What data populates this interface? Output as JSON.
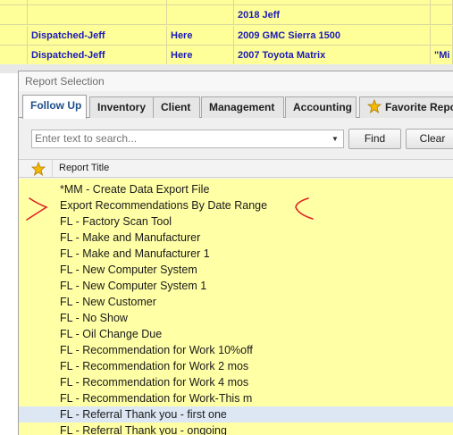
{
  "background_sheet": {
    "rows": [
      {
        "status": "",
        "location": "",
        "vehicle": "",
        "extra": ""
      },
      {
        "status": "",
        "location": "",
        "vehicle": "2018 Jeff",
        "extra": ""
      },
      {
        "status": "Dispatched-Jeff",
        "location": "Here",
        "vehicle": "2009 GMC Sierra 1500",
        "extra": ""
      },
      {
        "status": "Dispatched-Jeff",
        "location": "Here",
        "vehicle": "2007 Toyota Matrix",
        "extra": "\"Mi"
      }
    ]
  },
  "dialog": {
    "title": "Report Selection",
    "tabs": [
      {
        "label": "Follow Up",
        "active": true
      },
      {
        "label": "Inventory",
        "active": false
      },
      {
        "label": "Client",
        "active": false
      },
      {
        "label": "Management",
        "active": false
      },
      {
        "label": "Accounting",
        "active": false
      },
      {
        "label": "Favorite Repor",
        "active": false,
        "icon": "star-icon"
      }
    ],
    "search": {
      "placeholder": "Enter text to search...",
      "value": "",
      "find_label": "Find",
      "clear_label": "Clear"
    },
    "list_header": {
      "favorite_icon": "star-icon",
      "title": "Report Title"
    },
    "reports": [
      "*MM - Create Data Export File",
      "Export Recommendations By Date Range",
      "FL - Factory Scan Tool",
      "FL - Make and Manufacturer",
      "FL - Make and Manufacturer 1",
      "FL - New Computer System",
      "FL - New Computer System 1",
      "FL - New Customer",
      "FL - No Show",
      "FL - Oil Change Due",
      "FL - Recommendation for Work 10%off",
      "FL - Recommendation for Work 2 mos",
      "FL - Recommendation for Work 4 mos",
      "FL - Recommendation for Work-This m",
      "FL - Referral Thank you - first one",
      "FL - Referral Thank you - ongoing"
    ],
    "selected_index": 14
  },
  "colors": {
    "sheet_bg": "#ffff99",
    "sheet_text": "#1a1ab8",
    "list_bg": "#ffffa6",
    "selected_row": "#dde7f3",
    "annotation": "#e02020",
    "star": "#f5b800"
  }
}
